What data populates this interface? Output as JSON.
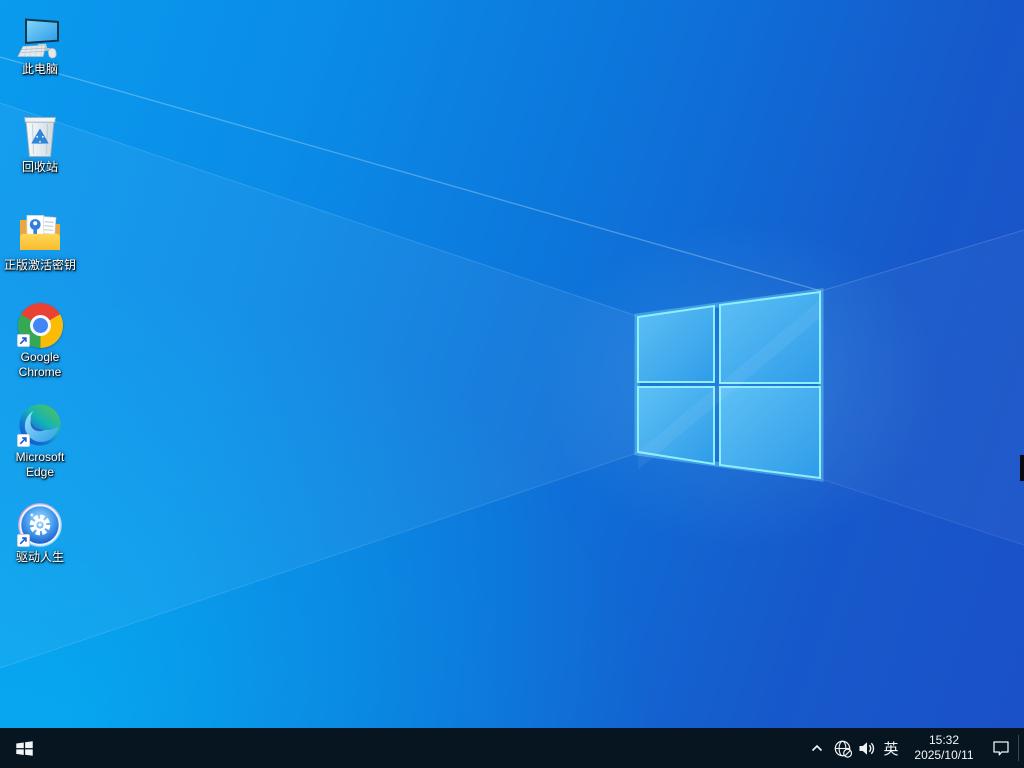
{
  "desktop": {
    "icons": [
      {
        "id": "this-pc",
        "label": "此电脑",
        "icon": "monitor-keyboard-icon",
        "shortcut_overlay": false
      },
      {
        "id": "recycle-bin",
        "label": "回收站",
        "icon": "recycle-bin-icon",
        "shortcut_overlay": false
      },
      {
        "id": "activation-key-folder",
        "label": "正版激活密钥",
        "icon": "folder-with-key-document-icon",
        "shortcut_overlay": false
      },
      {
        "id": "google-chrome",
        "label": "Google Chrome",
        "icon": "chrome-logo-icon",
        "shortcut_overlay": true
      },
      {
        "id": "microsoft-edge",
        "label": "Microsoft Edge",
        "icon": "edge-logo-icon",
        "shortcut_overlay": true
      },
      {
        "id": "driver-life",
        "label": "驱动人生",
        "icon": "blue-gear-badge-icon",
        "shortcut_overlay": true
      }
    ]
  },
  "taskbar": {
    "start": {
      "icon": "windows-flag-icon"
    },
    "tray": {
      "expand_icon": "chevron-up-icon",
      "network_icon": "globe-no-internet-icon",
      "volume_icon": "speaker-icon",
      "input_indicator": "英",
      "time": "15:32",
      "date": "2025/10/11",
      "action_center_icon": "notification-bubble-icon"
    }
  },
  "colors": {
    "wallpaper_left": "#00a2f0",
    "wallpaper_right": "#1b50c8",
    "logo_pane_edge": "#8df0ff",
    "taskbar_background": "#071520",
    "icon_label_text": "#ffffff"
  }
}
